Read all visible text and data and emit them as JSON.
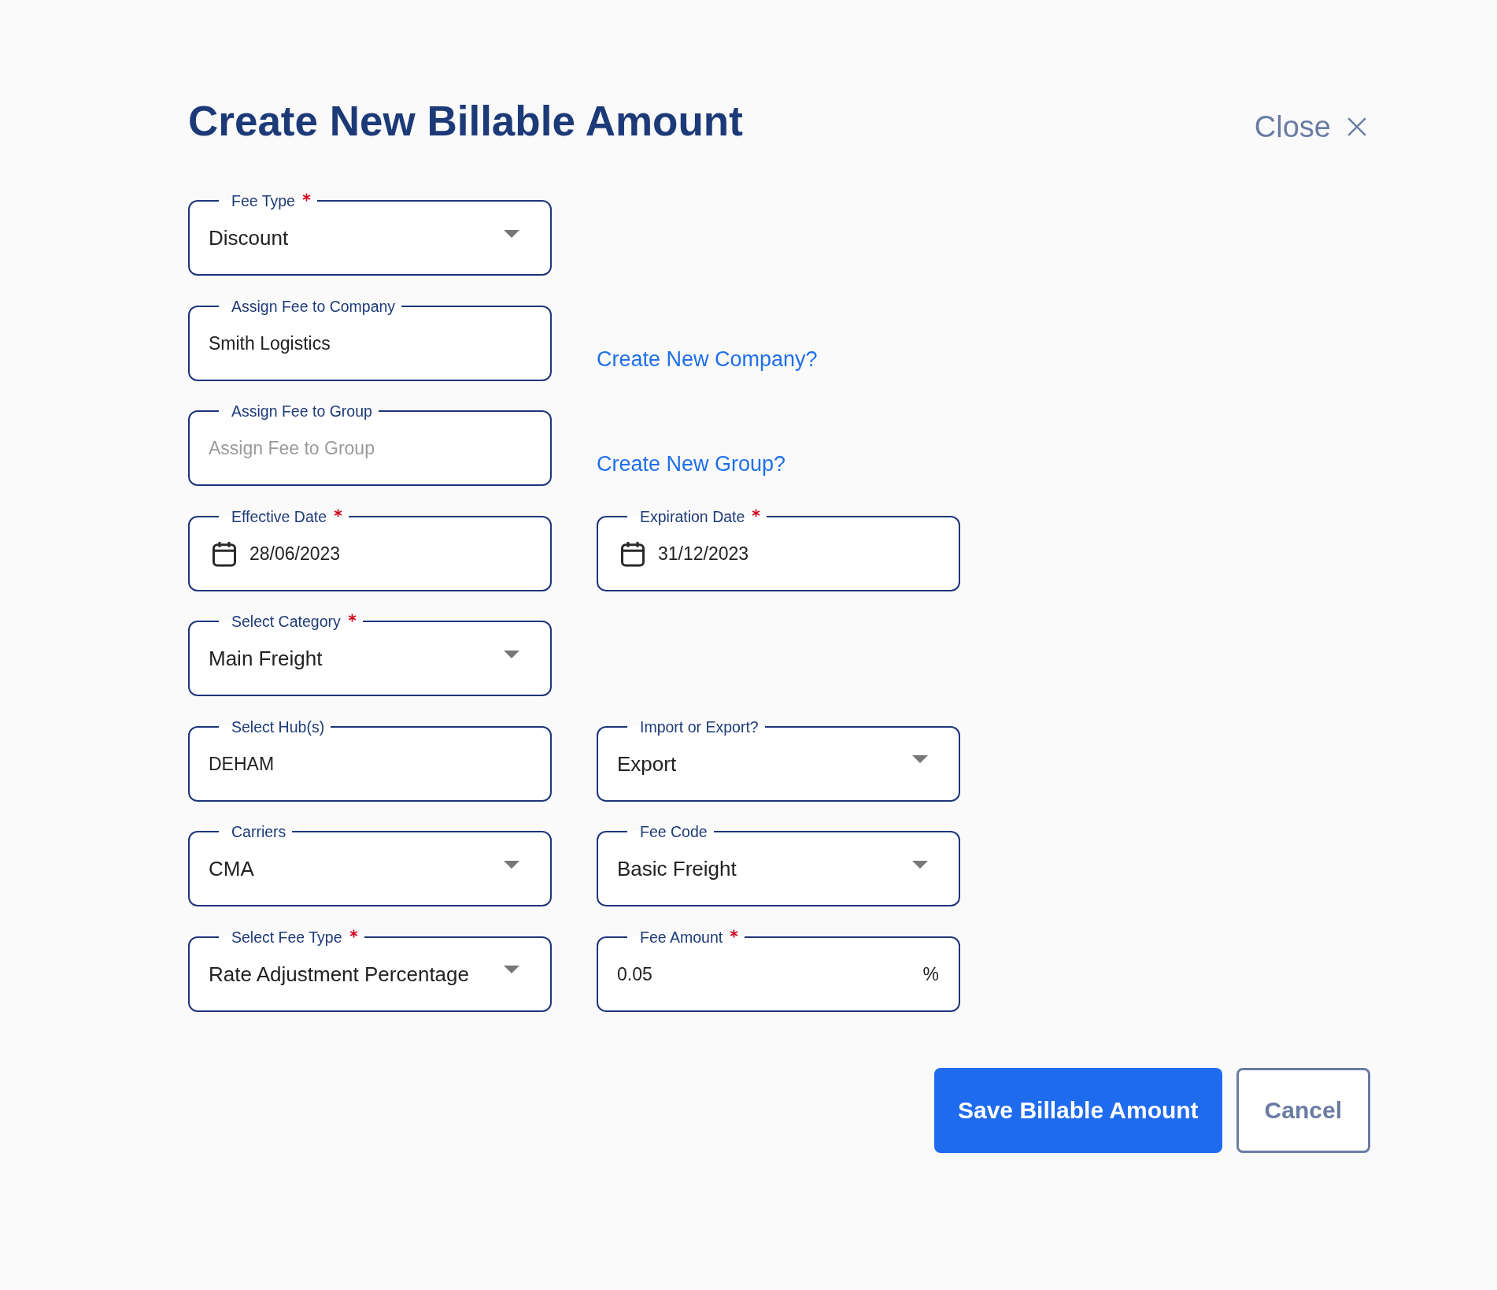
{
  "dialog": {
    "title": "Create New Billable Amount",
    "close_label": "Close"
  },
  "rows": [
    {
      "cells": [
        {
          "kind": "select",
          "label": "Fee Type",
          "required": true,
          "value": "Discount"
        }
      ]
    },
    {
      "cells": [
        {
          "kind": "text",
          "label": "Assign Fee to Company",
          "required": false,
          "value": "Smith Logistics"
        },
        {
          "kind": "link",
          "text": "Create New Company?"
        }
      ]
    },
    {
      "cells": [
        {
          "kind": "text",
          "label": "Assign Fee to Group",
          "required": false,
          "placeholder": "Assign Fee to Group"
        },
        {
          "kind": "link",
          "text": "Create New Group?"
        }
      ]
    },
    {
      "cells": [
        {
          "kind": "date",
          "label": "Effective Date",
          "required": true,
          "value": "28/06/2023"
        },
        {
          "kind": "date",
          "label": "Expiration Date",
          "required": true,
          "value": "31/12/2023"
        }
      ]
    },
    {
      "cells": [
        {
          "kind": "select",
          "label": "Select Category",
          "required": true,
          "value": "Main Freight"
        }
      ]
    },
    {
      "cells": [
        {
          "kind": "text",
          "label": "Select Hub(s)",
          "required": false,
          "value": "DEHAM"
        },
        {
          "kind": "select",
          "label": "Import or Export?",
          "required": false,
          "value": "Export"
        }
      ]
    },
    {
      "cells": [
        {
          "kind": "select",
          "label": "Carriers",
          "required": false,
          "value": "CMA"
        },
        {
          "kind": "select",
          "label": "Fee Code",
          "required": false,
          "value": "Basic Freight"
        }
      ]
    },
    {
      "cells": [
        {
          "kind": "select",
          "label": "Select Fee Type",
          "required": true,
          "value": "Rate Adjustment Percentage"
        },
        {
          "kind": "number",
          "label": "Fee Amount",
          "required": true,
          "value": "0.05",
          "suffix": "%"
        }
      ]
    }
  ],
  "buttons": [
    {
      "kind": "primary",
      "label": "Save Billable Amount"
    },
    {
      "kind": "secondary",
      "label": "Cancel"
    }
  ]
}
